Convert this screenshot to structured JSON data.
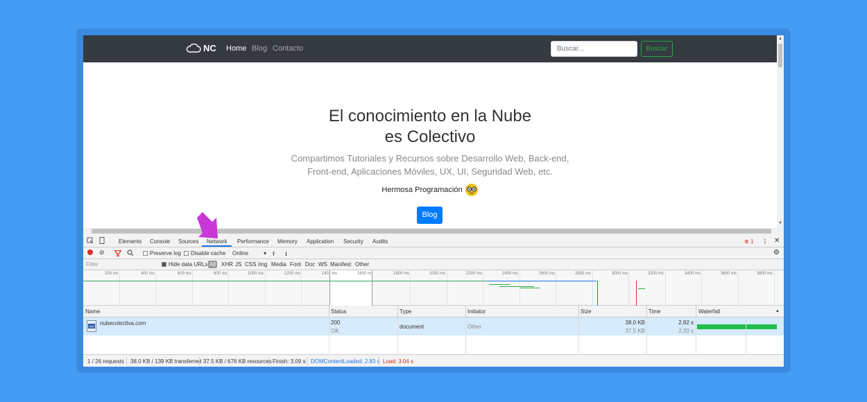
{
  "site": {
    "brand": "NC",
    "nav_links": [
      "Home",
      "Blog",
      "Contacto"
    ],
    "search_placeholder": "Buscar...",
    "search_button": "Buscar",
    "hero_title_line1": "El conocimiento en la Nube",
    "hero_title_line2": "es Colectivo",
    "hero_sub_line1": "Compartimos Tutoriales y Recursos sobre Desarrollo Web, Back-end,",
    "hero_sub_line2": "Front-end, Aplicaciones Móviles, UX, UI, Seguridad Web, etc.",
    "hero_tag": "Hermosa Programación",
    "hero_button": "Blog"
  },
  "devtools": {
    "tabs": [
      "Elements",
      "Console",
      "Sources",
      "Network",
      "Performance",
      "Memory",
      "Application",
      "Security",
      "Audits"
    ],
    "active_tab": "Network",
    "error_count": "1",
    "toolbar": {
      "preserve_log": "Preserve log",
      "disable_cache": "Disable cache",
      "throttle": "Online"
    },
    "filter": {
      "placeholder": "Filter",
      "hide_data_urls": "Hide data URLs",
      "types": [
        "All",
        "XHR",
        "JS",
        "CSS",
        "Img",
        "Media",
        "Font",
        "Doc",
        "WS",
        "Manifest",
        "Other"
      ]
    },
    "overview_ticks": [
      "200 ms",
      "400 ms",
      "600 ms",
      "800 ms",
      "1000 ms",
      "1200 ms",
      "140",
      "ms",
      "1600 m",
      "1800 ms",
      "2000 ms",
      "2200 ms",
      "2400 ms",
      "2600 ms",
      "2800 ms",
      "3000 ms",
      "3200 ms",
      "3400 ms",
      "3600 ms",
      "3800 ms"
    ],
    "columns": [
      "Name",
      "Status",
      "Type",
      "Initiator",
      "Size",
      "Time",
      "Waterfall"
    ],
    "row": {
      "name": "nubecolectiva.com",
      "status_code": "200",
      "status_text": "OK",
      "type": "document",
      "initiator": "Other",
      "size": "38.0 KB",
      "size_resource": "37.5 KB",
      "time": "2.82 s",
      "latency": "2.20 s"
    },
    "statusbar": {
      "requests": "1 / 26 requests",
      "transferred": "38.0 KB / 139 KB transferred",
      "resources": "37.5 KB / 676 KB resources",
      "finish": "Finish: 3.09 s",
      "dcl": "DOMContentLoaded: 2.83 s",
      "load": "Load: 3.04 s"
    }
  },
  "colors": {
    "background": "#459cf4",
    "navbar": "#343a40",
    "primary_button": "#007bff",
    "success": "#28a745",
    "dcl": "#1a73e8",
    "load": "#d93025",
    "arrow": "#c838d8"
  }
}
